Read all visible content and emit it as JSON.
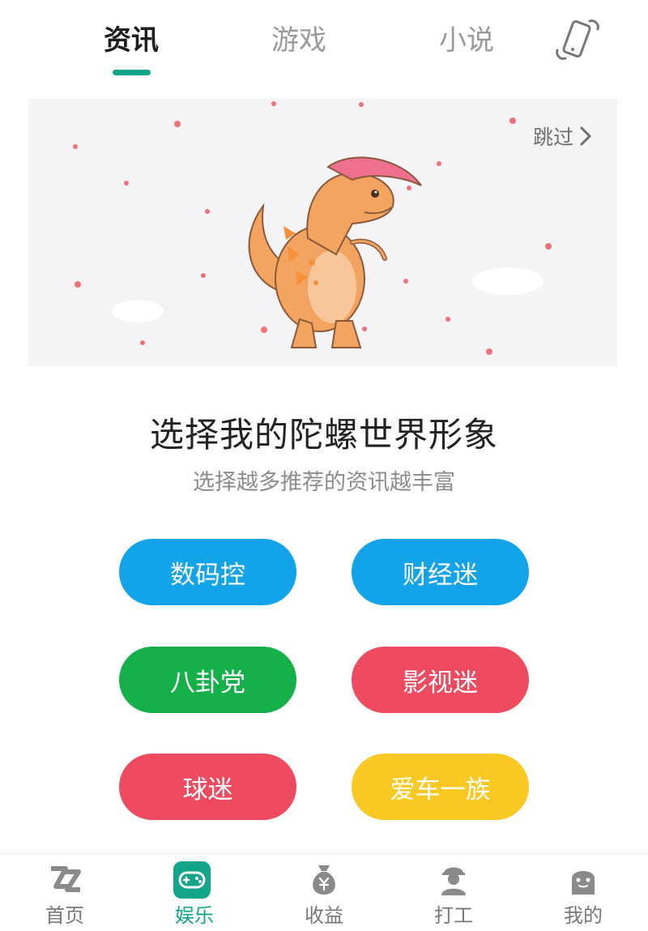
{
  "top_tabs": [
    {
      "label": "资讯",
      "active": true
    },
    {
      "label": "游戏",
      "active": false
    },
    {
      "label": "小说",
      "active": false
    }
  ],
  "top_tabs_right_icon": "phone-rotate-icon",
  "banner": {
    "skip_label": "跳过",
    "illustration": "dinosaur"
  },
  "heading": {
    "title": "选择我的陀螺世界形象",
    "subtitle": "选择越多推荐的资讯越丰富"
  },
  "categories": [
    {
      "label": "数码控",
      "color": "#13a3e8"
    },
    {
      "label": "财经迷",
      "color": "#13a3e8"
    },
    {
      "label": "八卦党",
      "color": "#16b04a"
    },
    {
      "label": "影视迷",
      "color": "#ee4a60"
    },
    {
      "label": "球迷",
      "color": "#ee4a60"
    },
    {
      "label": "爱车一族",
      "color": "#f9c823"
    }
  ],
  "bottom_nav": [
    {
      "label": "首页",
      "icon": "zz-logo-icon",
      "active": false
    },
    {
      "label": "娱乐",
      "icon": "gamepad-icon",
      "active": true
    },
    {
      "label": "收益",
      "icon": "money-bag-icon",
      "active": false
    },
    {
      "label": "打工",
      "icon": "worker-icon",
      "active": false
    },
    {
      "label": "我的",
      "icon": "ghost-face-icon",
      "active": false
    }
  ],
  "colors": {
    "accent": "#12a58a",
    "inactive_text": "#9a9a9a"
  }
}
